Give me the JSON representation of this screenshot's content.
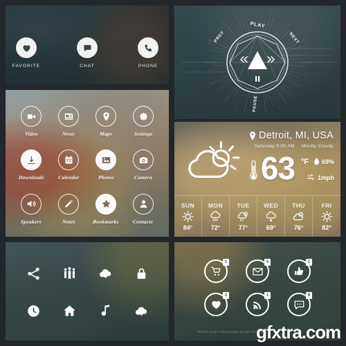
{
  "favorites": {
    "items": [
      {
        "label": "FAVORITE",
        "icon": "heart-icon"
      },
      {
        "label": "CHAT",
        "icon": "chat-icon"
      },
      {
        "label": "PHONE",
        "icon": "phone-icon"
      }
    ]
  },
  "app_grid": {
    "items": [
      {
        "label": "Video",
        "icon": "video-camera-icon",
        "style": "outline"
      },
      {
        "label": "News",
        "icon": "newspaper-icon",
        "style": "outline"
      },
      {
        "label": "Maps",
        "icon": "map-pin-icon",
        "style": "outline"
      },
      {
        "label": "Settings",
        "icon": "gear-icon",
        "style": "outline"
      },
      {
        "label": "Downloads",
        "icon": "download-icon",
        "style": "solid"
      },
      {
        "label": "Calendar",
        "icon": "calendar-icon",
        "style": "outline"
      },
      {
        "label": "Photos",
        "icon": "photo-icon",
        "style": "solid"
      },
      {
        "label": "Camera",
        "icon": "camera-icon",
        "style": "outline"
      },
      {
        "label": "Speakers",
        "icon": "speaker-icon",
        "style": "outline"
      },
      {
        "label": "Notes",
        "icon": "pencil-icon",
        "style": "outline"
      },
      {
        "label": "Bookmarks",
        "icon": "star-icon",
        "style": "solid"
      },
      {
        "label": "Contacts",
        "icon": "person-icon",
        "style": "outline"
      }
    ]
  },
  "tools": {
    "items": [
      {
        "icon": "share-icon"
      },
      {
        "icon": "people-group-icon"
      },
      {
        "icon": "cloud-download-icon"
      },
      {
        "icon": "lock-icon"
      },
      {
        "icon": "clock-icon"
      },
      {
        "icon": "home-icon"
      },
      {
        "icon": "music-note-icon"
      },
      {
        "icon": "cloud-upload-icon"
      }
    ]
  },
  "music": {
    "play_label": "PLAY",
    "prev_label": "PREV",
    "next_label": "NEXT",
    "pause_label": "PAUSE",
    "center_icon": "play-triangle-icon",
    "pause_icon": "pause-bars-icon",
    "prev_icon": "prev-chevrons-icon",
    "next_icon": "next-chevrons-icon"
  },
  "weather": {
    "location": "Detroit, MI, USA",
    "location_icon": "map-pin-icon",
    "day_time": "Saturday 9:00 AM",
    "condition": "Mostly Cloudy",
    "condition_icon": "sun-behind-cloud-icon",
    "temperature": "63",
    "unit": "°F",
    "thermometer_icon": "thermometer-icon",
    "humidity": "69%",
    "humidity_icon": "droplet-icon",
    "wind": "1mph",
    "wind_icon": "wind-icon",
    "forecast": [
      {
        "day": "SUN",
        "icon": "sun-icon",
        "temp": "84°"
      },
      {
        "day": "MON",
        "icon": "rain-icon",
        "temp": "72°"
      },
      {
        "day": "TUE",
        "icon": "sun-rain-icon",
        "temp": "77°"
      },
      {
        "day": "WED",
        "icon": "cloud-rain-icon",
        "temp": "69°"
      },
      {
        "day": "THU",
        "icon": "partly-cloudy-icon",
        "temp": "76°"
      },
      {
        "day": "FRI",
        "icon": "sun-icon",
        "temp": "82°"
      }
    ]
  },
  "social": {
    "items": [
      {
        "icon": "cart-icon",
        "badge": "1"
      },
      {
        "icon": "envelope-icon",
        "badge": "5"
      },
      {
        "icon": "thumbs-up-icon",
        "badge": "1"
      },
      {
        "icon": "heart-icon",
        "badge": "2"
      },
      {
        "icon": "rss-icon",
        "badge": "1"
      },
      {
        "icon": "chat-icon",
        "badge": "9"
      }
    ],
    "credit": "Photos used in this preview are not included"
  },
  "watermark": {
    "text": "gfxtra.com"
  },
  "colors": {
    "separator": "#23262b",
    "icon_white": "#ffffff",
    "favorite_glyph": "#31464d"
  }
}
